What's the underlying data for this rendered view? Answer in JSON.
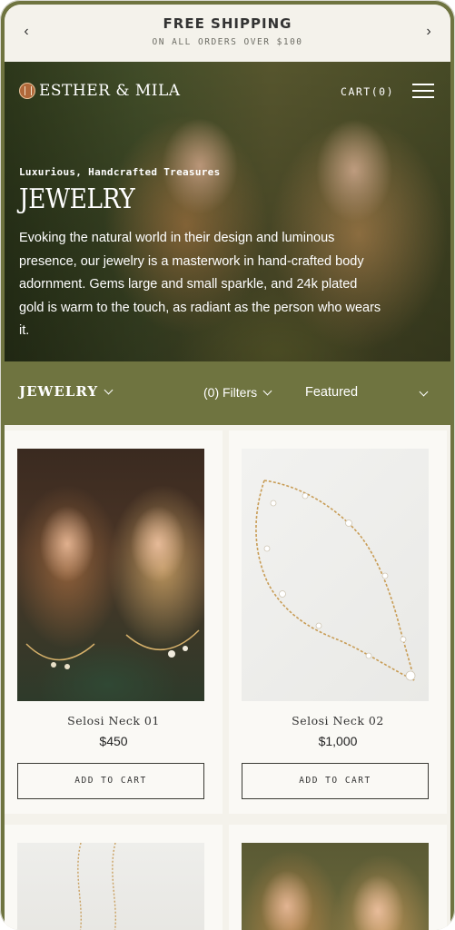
{
  "announcement": {
    "title": "FREE SHIPPING",
    "subtitle": "ON ALL ORDERS OVER $100",
    "prev_icon": "chevron-left-icon",
    "next_icon": "chevron-right-icon"
  },
  "header": {
    "brand": "ESTHER & MILA",
    "cart_label": "CART(0)",
    "menu_icon": "hamburger-menu-icon"
  },
  "hero": {
    "eyebrow": "Luxurious, Handcrafted Treasures",
    "title": "JEWELRY",
    "description": "Evoking the natural world in their design and luminous presence, our jewelry is a masterwork in hand-crafted body adornment. Gems large and small sparkle, and 24k plated gold is warm to the touch, as radiant as the person who wears it."
  },
  "filter_bar": {
    "category": "JEWELRY",
    "filters_label": "(0) Filters",
    "sort_label": "Featured"
  },
  "products": [
    {
      "name": "Selosi Neck 01",
      "price": "$450",
      "button": "ADD TO CART"
    },
    {
      "name": "Selosi Neck 02",
      "price": "$1,000",
      "button": "ADD TO CART"
    },
    {
      "name": "",
      "price": "",
      "button": ""
    },
    {
      "name": "",
      "price": "",
      "button": ""
    }
  ],
  "colors": {
    "olive": "#6f7440",
    "cream": "#f4f2eb",
    "card": "#faf9f5"
  }
}
